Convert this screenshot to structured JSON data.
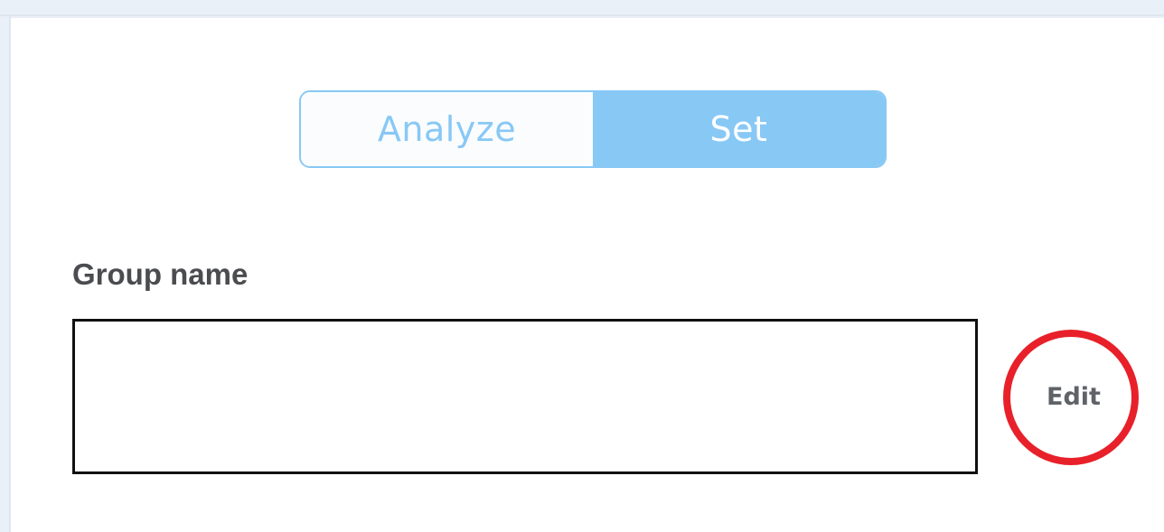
{
  "mode_toggle": {
    "options": [
      {
        "label": "Analyze",
        "selected": false
      },
      {
        "label": "Set",
        "selected": true
      }
    ],
    "accent_color": "#88c8f5"
  },
  "group_name": {
    "label": "Group name",
    "value": "",
    "placeholder": ""
  },
  "edit_button": {
    "label": "Edit",
    "highlight_color": "#e8202a"
  }
}
